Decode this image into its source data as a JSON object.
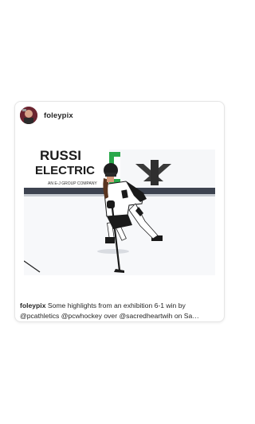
{
  "post": {
    "username": "foleypix",
    "caption": {
      "username": "foleypix",
      "line1": "Some highlights from an exhibition 6-1 win by",
      "line2": "@pcathletics @pcwhockey over @sacredheartwih on Sa…"
    },
    "media": {
      "board_text_top": "RUSSI",
      "board_text_main": "ELECTRIC",
      "board_text_sub": "AN E-J GROUP COMPANY",
      "player_jersey_color": "#ffffff",
      "player_trim_color": "#111111"
    }
  },
  "icons": {
    "carousel": "multiple-images-icon",
    "avatar": "profile-photo"
  },
  "colors": {
    "accent_green": "#2aa84a",
    "text": "#262626",
    "card_border": "#e6e6e6"
  }
}
